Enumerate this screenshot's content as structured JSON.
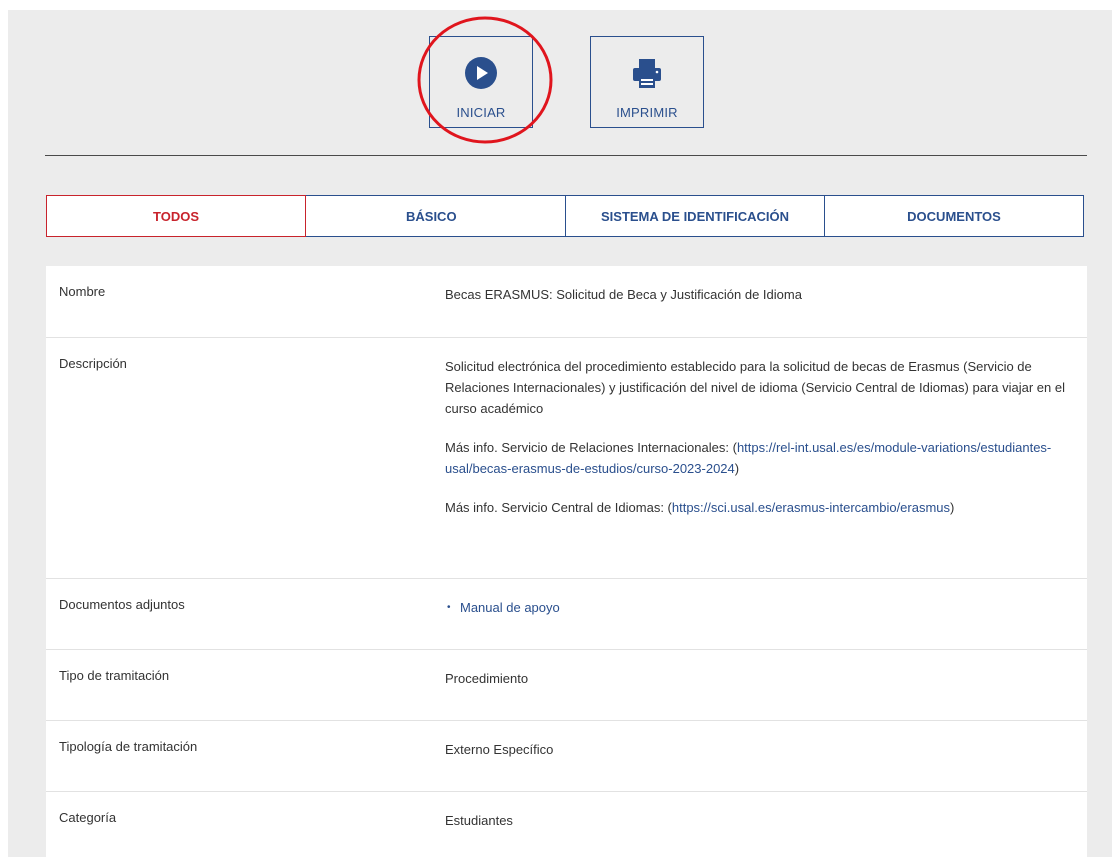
{
  "actions": {
    "start_label": "INICIAR",
    "print_label": "IMPRIMIR"
  },
  "tabs": [
    {
      "label": "TODOS",
      "active": true
    },
    {
      "label": "BÁSICO",
      "active": false
    },
    {
      "label": "SISTEMA DE IDENTIFICACIÓN",
      "active": false
    },
    {
      "label": "DOCUMENTOS",
      "active": false
    }
  ],
  "details": {
    "nombre": {
      "key": "Nombre",
      "value": "Becas ERASMUS: Solicitud de Beca y Justificación de Idioma"
    },
    "descripcion": {
      "key": "Descripción",
      "paragraph1": "Solicitud electrónica del procedimiento establecido para la solicitud de becas de Erasmus (Servicio de Relaciones Internacionales) y justificación del nivel de idioma (Servicio Central de Idiomas) para viajar en el curso académico",
      "info1_prefix": "Más info. Servicio de Relaciones Internacionales: (",
      "info1_link": "https://rel-int.usal.es/es/module-variations/estudiantes-usal/becas-erasmus-de-estudios/curso-2023-2024",
      "info1_suffix": ")",
      "info2_prefix": "Más info. Servicio Central de Idiomas: (",
      "info2_link": "https://sci.usal.es/erasmus-intercambio/erasmus",
      "info2_suffix": ")"
    },
    "documentos": {
      "key": "Documentos adjuntos",
      "items": [
        "Manual de apoyo"
      ]
    },
    "tipo": {
      "key": "Tipo de tramitación",
      "value": "Procedimiento"
    },
    "tipologia": {
      "key": "Tipología de tramitación",
      "value": "Externo Específico"
    },
    "categoria": {
      "key": "Categoría",
      "value": "Estudiantes"
    }
  },
  "colors": {
    "accent_blue": "#2a4f8d",
    "active_red": "#c8232c",
    "highlight_circle": "#e0151d",
    "panel_bg": "#ececec"
  },
  "icons": {
    "start": "play-circle-icon",
    "print": "printer-icon"
  }
}
